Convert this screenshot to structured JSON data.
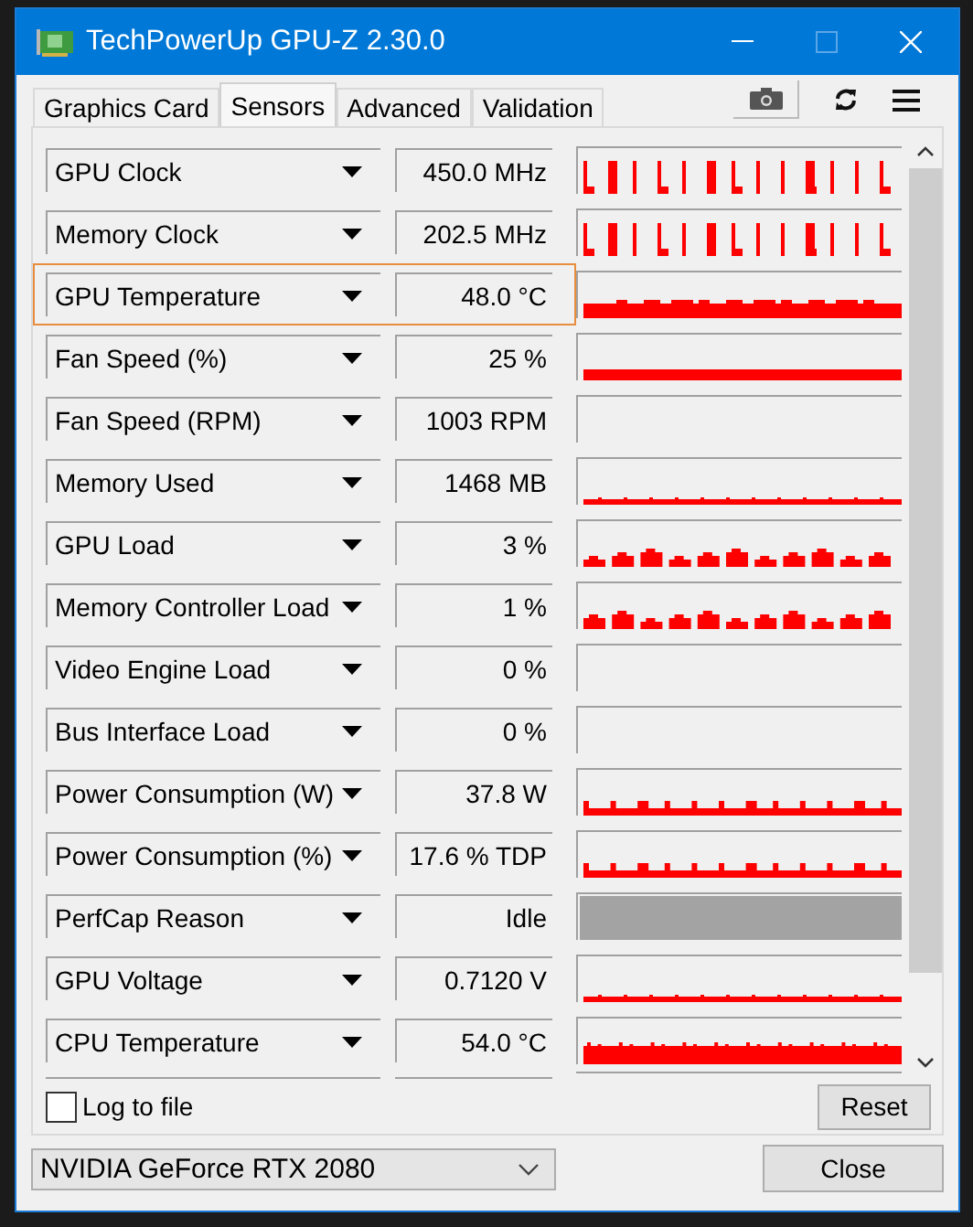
{
  "window": {
    "title": "TechPowerUp GPU-Z 2.30.0"
  },
  "tabs": [
    {
      "label": "Graphics Card",
      "selected": false
    },
    {
      "label": "Sensors",
      "selected": true
    },
    {
      "label": "Advanced",
      "selected": false
    },
    {
      "label": "Validation",
      "selected": false
    }
  ],
  "sensors": [
    {
      "name": "GPU Clock",
      "value": "450.0 MHz",
      "kind": "spikes",
      "highlighted": false
    },
    {
      "name": "Memory Clock",
      "value": "202.5 MHz",
      "kind": "spikes",
      "highlighted": false
    },
    {
      "name": "GPU Temperature",
      "value": "48.0 °C",
      "kind": "block",
      "highlighted": true
    },
    {
      "name": "Fan Speed (%)",
      "value": "25 %",
      "kind": "bar",
      "highlighted": false
    },
    {
      "name": "Fan Speed (RPM)",
      "value": "1003 RPM",
      "kind": "empty",
      "highlighted": false
    },
    {
      "name": "Memory Used",
      "value": "1468 MB",
      "kind": "line",
      "highlighted": false
    },
    {
      "name": "GPU Load",
      "value": "3 %",
      "kind": "bursts",
      "highlighted": false
    },
    {
      "name": "Memory Controller Load",
      "value": "1 %",
      "kind": "bursts",
      "highlighted": false
    },
    {
      "name": "Video Engine Load",
      "value": "0 %",
      "kind": "empty",
      "highlighted": false
    },
    {
      "name": "Bus Interface Load",
      "value": "0 %",
      "kind": "empty",
      "highlighted": false
    },
    {
      "name": "Power Consumption (W)",
      "value": "37.8 W",
      "kind": "pulses",
      "highlighted": false
    },
    {
      "name": "Power Consumption (%)",
      "value": "17.6 % TDP",
      "kind": "pulses",
      "highlighted": false
    },
    {
      "name": "PerfCap Reason",
      "value": "Idle",
      "kind": "solid",
      "highlighted": false
    },
    {
      "name": "GPU Voltage",
      "value": "0.7120 V",
      "kind": "line",
      "highlighted": false
    },
    {
      "name": "CPU Temperature",
      "value": "54.0 °C",
      "kind": "noise",
      "highlighted": false
    }
  ],
  "log_to_file": {
    "label": "Log to file",
    "checked": false
  },
  "reset_button": "Reset",
  "gpu_select": {
    "value": "NVIDIA GeForce RTX 2080"
  },
  "close_button": "Close"
}
